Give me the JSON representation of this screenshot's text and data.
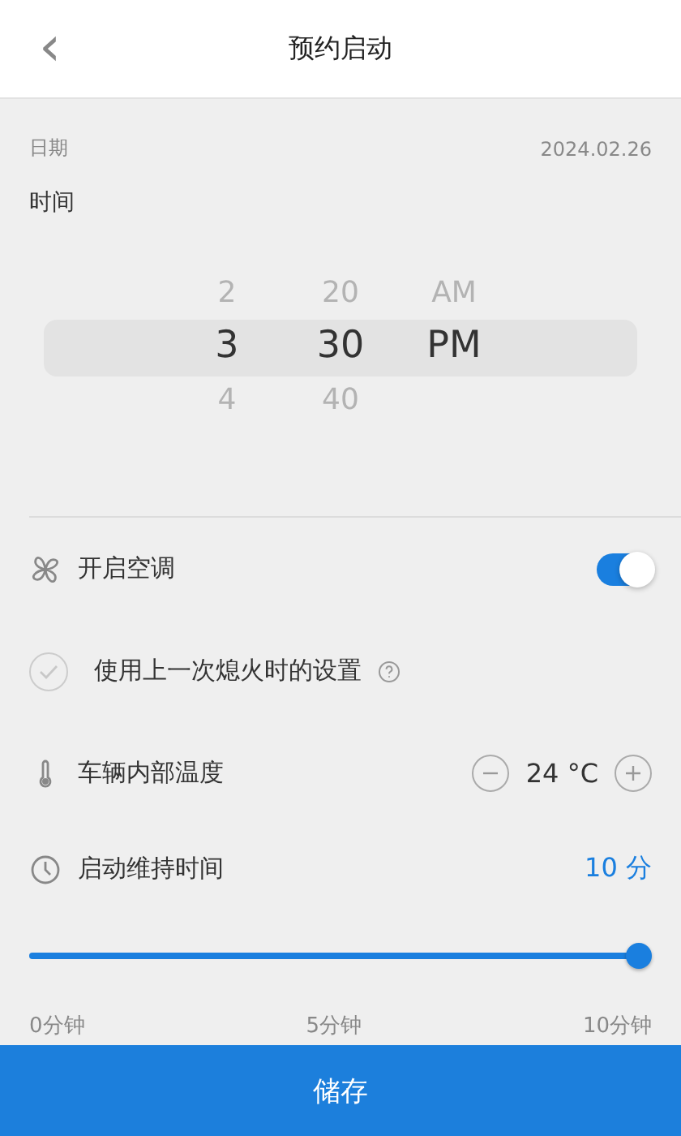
{
  "header": {
    "back_icon": "‹",
    "title": "预约启动"
  },
  "date": {
    "label": "日期",
    "value": "2024.02.26"
  },
  "time": {
    "label": "时间",
    "columns": [
      {
        "items": [
          {
            "label": "2",
            "selected": false
          },
          {
            "label": "3",
            "selected": true
          },
          {
            "label": "4",
            "selected": false
          }
        ]
      },
      {
        "items": [
          {
            "label": "20",
            "selected": false
          },
          {
            "label": "30",
            "selected": true
          },
          {
            "label": "40",
            "selected": false
          }
        ]
      },
      {
        "items": [
          {
            "label": "AM",
            "selected": false
          },
          {
            "label": "PM",
            "selected": true
          }
        ]
      }
    ]
  },
  "air_conditioning": {
    "label": "开启空调",
    "on": true
  },
  "use_last_settings": {
    "label": "使用上一次熄火时的设置",
    "checked": false
  },
  "temperature": {
    "label": "车辆内部温度",
    "value": "24 °C"
  },
  "duration": {
    "label": "启动维持时间",
    "value": "10 分",
    "level": 1,
    "ticks": [
      "0分钟",
      "5分钟",
      "10分钟"
    ]
  },
  "save_button": "储存"
}
